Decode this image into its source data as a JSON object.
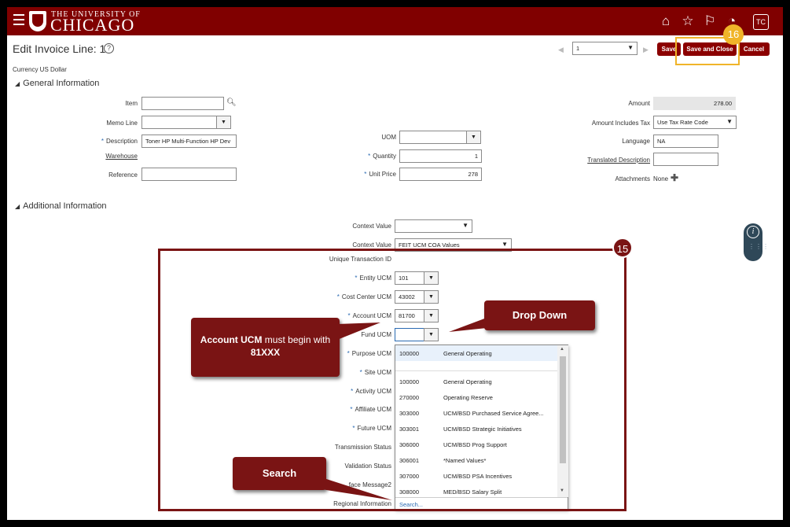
{
  "header": {
    "university_line1": "THE UNIVERSITY OF",
    "university_line2": "CHICAGO",
    "avatar_initials": "TC"
  },
  "page": {
    "title": "Edit Invoice Line: 1",
    "help": "?",
    "currency": "Currency US Dollar",
    "pager_value": "1",
    "save": "Save",
    "save_close": "Save and Close",
    "cancel": "Cancel"
  },
  "general": {
    "title": "General Information",
    "item_label": "Item",
    "memo_label": "Memo Line",
    "description_label": "Description",
    "description_value": "Toner HP Multi-Function HP Dev",
    "warehouse_label": "Warehouse",
    "reference_label": "Reference",
    "uom_label": "UOM",
    "quantity_label": "Quantity",
    "quantity_value": "1",
    "unit_price_label": "Unit Price",
    "unit_price_value": "278",
    "amount_label": "Amount",
    "amount_value": "278.00",
    "amount_tax_label": "Amount Includes Tax",
    "amount_tax_value": "Use Tax Rate Code",
    "language_label": "Language",
    "language_value": "NA",
    "translated_label": "Translated Description",
    "attachments_label": "Attachments",
    "attachments_value": "None"
  },
  "additional": {
    "title": "Additional Information",
    "context1_label": "Context Value",
    "context2_label": "Context Value",
    "context2_value": "FEIT UCM COA Values",
    "unique_label": "Unique Transaction ID",
    "entity_label": "Entity UCM",
    "entity_value": "101",
    "cost_center_label": "Cost Center UCM",
    "cost_center_value": "43002",
    "account_label": "Account UCM",
    "account_value": "81700",
    "fund_label": "Fund UCM",
    "purpose_label": "Purpose UCM",
    "site_label": "Site UCM",
    "activity_label": "Activity UCM",
    "affiliate_label": "Affiliate UCM",
    "future_label": "Future UCM",
    "transmission_label": "Transmission Status",
    "validation_label": "Validation Status",
    "interface_label": "face Message2",
    "regional_label": "Regional Information"
  },
  "fund_list": {
    "selected": {
      "code": "100000",
      "name": "General Operating"
    },
    "items": [
      {
        "code": "100000",
        "name": "General Operating"
      },
      {
        "code": "270000",
        "name": "Operating Reserve"
      },
      {
        "code": "303000",
        "name": "UCM/BSD Purchased Service Agree..."
      },
      {
        "code": "303001",
        "name": "UCM/BSD Strategic Initiatives"
      },
      {
        "code": "306000",
        "name": "UCM/BSD Prog Support"
      },
      {
        "code": "306001",
        "name": "*Named Values*"
      },
      {
        "code": "307000",
        "name": "UCM/BSD PSA Incentives"
      },
      {
        "code": "308000",
        "name": "MED/BSD Salary Split"
      }
    ],
    "search": "Search..."
  },
  "annotations": {
    "badge15": "15",
    "badge16": "16",
    "account_callout_bold": "Account UCM",
    "account_callout_text": " must begin with ",
    "account_callout_bold2": "81XXX",
    "dropdown_callout": "Drop Down",
    "search_callout": "Search"
  },
  "colors": {
    "brand": "#800000",
    "callout": "#7a1414",
    "highlight": "#f0b429"
  }
}
